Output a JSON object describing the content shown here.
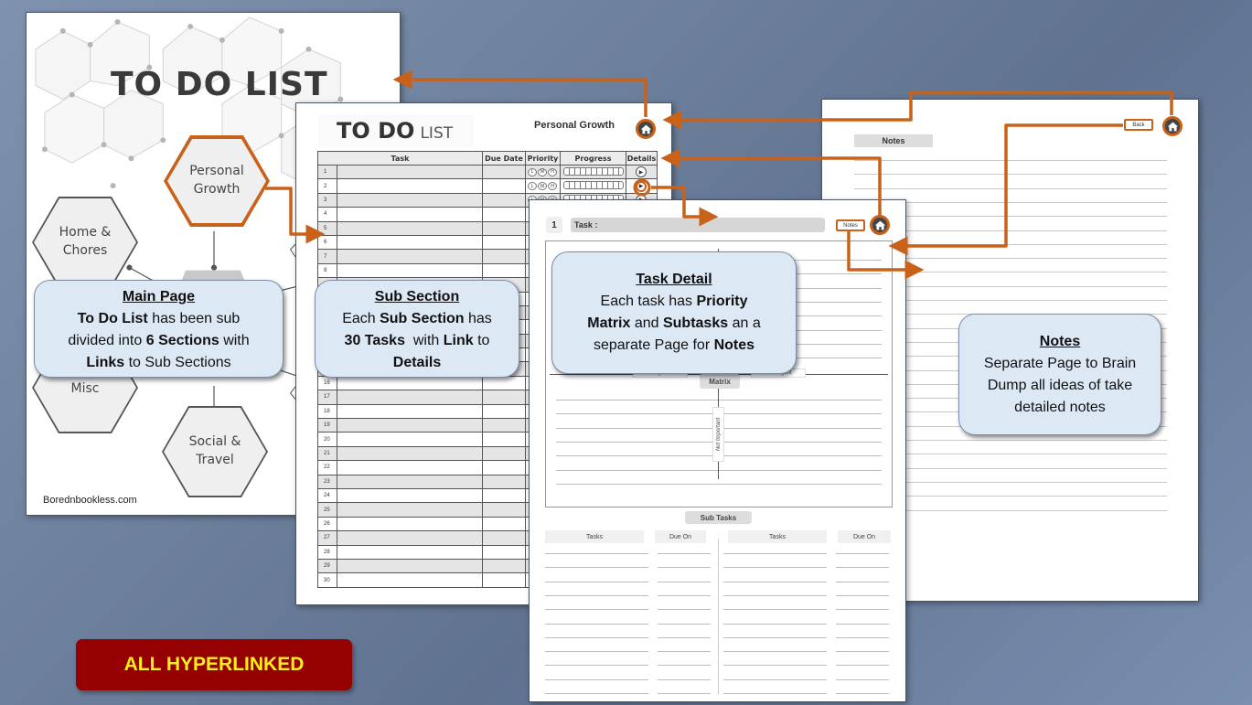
{
  "main_page": {
    "title": "TO DO LIST",
    "sections": [
      {
        "label": "Personal\nGrowth",
        "active": true
      },
      {
        "label": "Home &\nChores",
        "active": false
      },
      {
        "label": "Misc",
        "active": false
      },
      {
        "label": "Social &\nTravel",
        "active": false
      }
    ],
    "footer": "Borednbookless.com"
  },
  "sub_page": {
    "title_big": "TO DO",
    "title_small": "LIST",
    "section_name": "Personal Growth",
    "columns": [
      "Task",
      "Due Date",
      "Priority",
      "Progress",
      "Details"
    ],
    "priority_options": [
      "L",
      "M",
      "H"
    ],
    "row_count": 30
  },
  "detail_page": {
    "task_number": "1",
    "task_label": "Task :",
    "notes_button": "Notes",
    "matrix_label": "Matrix",
    "urgent_label": "Urgent",
    "not_urgent_label": "Not Urgent",
    "not_important_label": "Not Important",
    "subtasks_label": "Sub Tasks",
    "subtask_columns": [
      "Tasks",
      "Due On",
      "Tasks",
      "Due On"
    ]
  },
  "notes_page": {
    "header": "Notes",
    "back_button": "Back"
  },
  "callouts": {
    "main": {
      "title": "Main Page",
      "l1a": "To Do List",
      "l1b": " has been sub",
      "l2a": "divided into ",
      "l2b": "6 Sections",
      "l2c": " with",
      "l3a": "Links",
      "l3b": " to Sub Sections"
    },
    "sub": {
      "title": "Sub Section",
      "l1a": "Each ",
      "l1b": "Sub Section",
      "l1c": " has",
      "l2a": "30 Tasks",
      "l2b": "  with ",
      "l2c": "Link",
      "l2d": " to",
      "l3a": "Details"
    },
    "detail": {
      "title": "Task Detail",
      "l1a": "Each task has ",
      "l1b": "Priority",
      "l2a": "Matrix",
      "l2b": " and ",
      "l2c": "Subtasks",
      "l2d": " an a",
      "l3a": "separate Page for ",
      "l3b": "Notes"
    },
    "notes": {
      "title": "Notes",
      "l1": "Separate Page to Brain",
      "l2": "Dump all ideas of take",
      "l3": "detailed notes"
    }
  },
  "banner": {
    "label": "ALL HYPERLINKED"
  },
  "colors": {
    "link_orange": "#c8621a",
    "callout_bg": "#dde8f5",
    "banner_bg": "#950000",
    "banner_text": "#ffee1f"
  }
}
